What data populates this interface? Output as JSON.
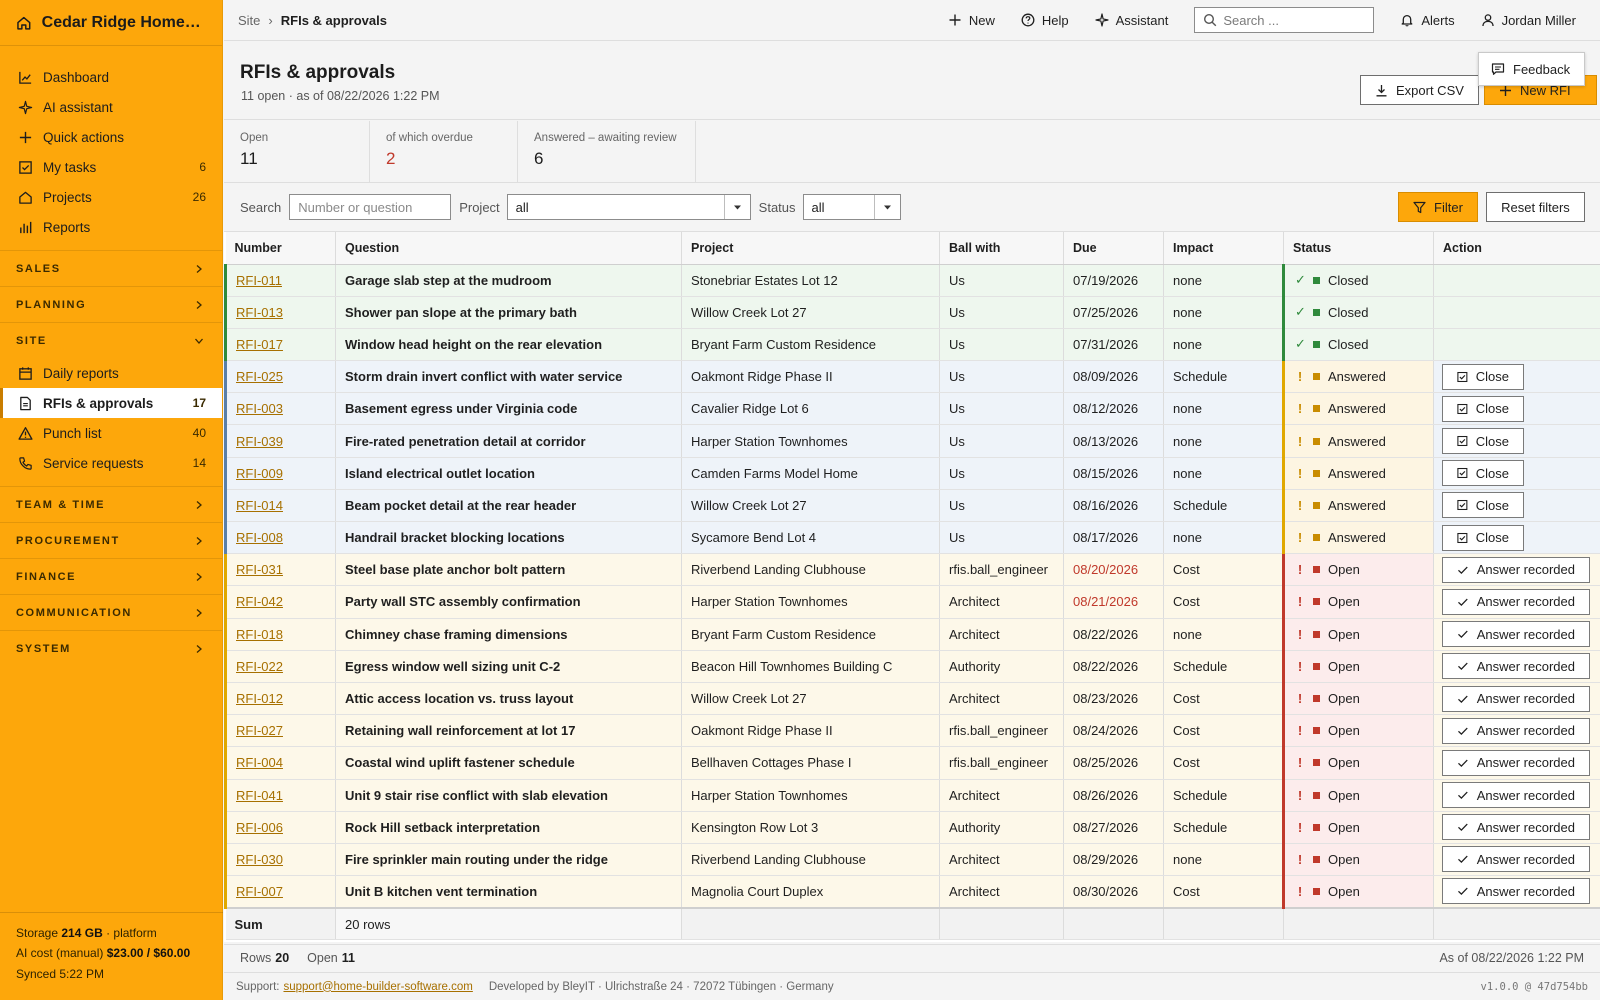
{
  "app": {
    "title": "Cedar Ridge Homes LLC"
  },
  "sidebar": {
    "items": [
      {
        "label": "Dashboard",
        "count": ""
      },
      {
        "label": "AI assistant",
        "count": ""
      },
      {
        "label": "Quick actions",
        "count": ""
      },
      {
        "label": "My tasks",
        "count": "6"
      },
      {
        "label": "Projects",
        "count": "26"
      },
      {
        "label": "Reports",
        "count": ""
      }
    ],
    "sections": {
      "sales": "SALES",
      "planning": "PLANNING",
      "site": "SITE",
      "team": "TEAM & TIME",
      "procurement": "PROCUREMENT",
      "finance": "FINANCE",
      "communication": "COMMUNICATION",
      "system": "SYSTEM"
    },
    "site_items": [
      {
        "label": "Daily reports",
        "count": ""
      },
      {
        "label": "RFIs & approvals",
        "count": "17"
      },
      {
        "label": "Punch list",
        "count": "40"
      },
      {
        "label": "Service requests",
        "count": "14"
      }
    ],
    "footer": {
      "storage_label": "Storage",
      "storage_value": "214 GB",
      "storage_suffix": "· platform",
      "ai_label": "AI cost (manual)",
      "ai_value": "$23.00 / $60.00",
      "synced": "Synced 5:22 PM"
    }
  },
  "topbar": {
    "crumb_root": "Site",
    "crumb_sep": "›",
    "crumb_current": "RFIs & approvals",
    "new_label": "New",
    "help_label": "Help",
    "assistant_label": "Assistant",
    "search_placeholder": "Search ...",
    "alerts_label": "Alerts",
    "user_name": "Jordan Miller"
  },
  "header": {
    "title": "RFIs & approvals",
    "subtitle": "11 open · as of 08/22/2026 1:22 PM",
    "export_label": "Export CSV",
    "new_rfi_label": "New RFI",
    "feedback_label": "Feedback"
  },
  "stats": [
    {
      "label": "Open",
      "value": "11"
    },
    {
      "label": "of which overdue",
      "value": "2"
    },
    {
      "label": "Answered – awaiting review",
      "value": "6"
    }
  ],
  "filters": {
    "search_label": "Search",
    "search_placeholder": "Number or question",
    "project_label": "Project",
    "project_value": "all",
    "status_label": "Status",
    "status_value": "all",
    "filter_label": "Filter",
    "reset_label": "Reset filters"
  },
  "table": {
    "columns": [
      "Number",
      "Question",
      "Project",
      "Ball with",
      "Due",
      "Impact",
      "Status",
      "Action"
    ],
    "rows": [
      {
        "number": "RFI-011",
        "question": "Garage slab step at the mudroom",
        "project": "Stonebriar Estates Lot 12",
        "ball": "Us",
        "due": "07/19/2026",
        "impact": "none",
        "status": "Closed",
        "action": ""
      },
      {
        "number": "RFI-013",
        "question": "Shower pan slope at the primary bath",
        "project": "Willow Creek Lot 27",
        "ball": "Us",
        "due": "07/25/2026",
        "impact": "none",
        "status": "Closed",
        "action": ""
      },
      {
        "number": "RFI-017",
        "question": "Window head height on the rear elevation",
        "project": "Bryant Farm Custom Residence",
        "ball": "Us",
        "due": "07/31/2026",
        "impact": "none",
        "status": "Closed",
        "action": ""
      },
      {
        "number": "RFI-025",
        "question": "Storm drain invert conflict with water service",
        "project": "Oakmont Ridge Phase II",
        "ball": "Us",
        "due": "08/09/2026",
        "impact": "Schedule",
        "status": "Answered",
        "action": "Close"
      },
      {
        "number": "RFI-003",
        "question": "Basement egress under Virginia code",
        "project": "Cavalier Ridge Lot 6",
        "ball": "Us",
        "due": "08/12/2026",
        "impact": "none",
        "status": "Answered",
        "action": "Close"
      },
      {
        "number": "RFI-039",
        "question": "Fire-rated penetration detail at corridor",
        "project": "Harper Station Townhomes",
        "ball": "Us",
        "due": "08/13/2026",
        "impact": "none",
        "status": "Answered",
        "action": "Close"
      },
      {
        "number": "RFI-009",
        "question": "Island electrical outlet location",
        "project": "Camden Farms Model Home",
        "ball": "Us",
        "due": "08/15/2026",
        "impact": "none",
        "status": "Answered",
        "action": "Close"
      },
      {
        "number": "RFI-014",
        "question": "Beam pocket detail at the rear header",
        "project": "Willow Creek Lot 27",
        "ball": "Us",
        "due": "08/16/2026",
        "impact": "Schedule",
        "status": "Answered",
        "action": "Close"
      },
      {
        "number": "RFI-008",
        "question": "Handrail bracket blocking locations",
        "project": "Sycamore Bend Lot 4",
        "ball": "Us",
        "due": "08/17/2026",
        "impact": "none",
        "status": "Answered",
        "action": "Close"
      },
      {
        "number": "RFI-031",
        "question": "Steel base plate anchor bolt pattern",
        "project": "Riverbend Landing Clubhouse",
        "ball": "rfis.ball_engineer",
        "due": "08/20/2026",
        "impact": "Cost",
        "status": "Open",
        "action": "Answer recorded",
        "overdue": true
      },
      {
        "number": "RFI-042",
        "question": "Party wall STC assembly confirmation",
        "project": "Harper Station Townhomes",
        "ball": "Architect",
        "due": "08/21/2026",
        "impact": "Cost",
        "status": "Open",
        "action": "Answer recorded",
        "overdue": true
      },
      {
        "number": "RFI-018",
        "question": "Chimney chase framing dimensions",
        "project": "Bryant Farm Custom Residence",
        "ball": "Architect",
        "due": "08/22/2026",
        "impact": "none",
        "status": "Open",
        "action": "Answer recorded"
      },
      {
        "number": "RFI-022",
        "question": "Egress window well sizing unit C-2",
        "project": "Beacon Hill Townhomes Building C",
        "ball": "Authority",
        "due": "08/22/2026",
        "impact": "Schedule",
        "status": "Open",
        "action": "Answer recorded"
      },
      {
        "number": "RFI-012",
        "question": "Attic access location vs. truss layout",
        "project": "Willow Creek Lot 27",
        "ball": "Architect",
        "due": "08/23/2026",
        "impact": "Cost",
        "status": "Open",
        "action": "Answer recorded"
      },
      {
        "number": "RFI-027",
        "question": "Retaining wall reinforcement at lot 17",
        "project": "Oakmont Ridge Phase II",
        "ball": "rfis.ball_engineer",
        "due": "08/24/2026",
        "impact": "Cost",
        "status": "Open",
        "action": "Answer recorded"
      },
      {
        "number": "RFI-004",
        "question": "Coastal wind uplift fastener schedule",
        "project": "Bellhaven Cottages Phase I",
        "ball": "rfis.ball_engineer",
        "due": "08/25/2026",
        "impact": "Cost",
        "status": "Open",
        "action": "Answer recorded"
      },
      {
        "number": "RFI-041",
        "question": "Unit 9 stair rise conflict with slab elevation",
        "project": "Harper Station Townhomes",
        "ball": "Architect",
        "due": "08/26/2026",
        "impact": "Schedule",
        "status": "Open",
        "action": "Answer recorded"
      },
      {
        "number": "RFI-006",
        "question": "Rock Hill setback interpretation",
        "project": "Kensington Row Lot 3",
        "ball": "Authority",
        "due": "08/27/2026",
        "impact": "Schedule",
        "status": "Open",
        "action": "Answer recorded"
      },
      {
        "number": "RFI-030",
        "question": "Fire sprinkler main routing under the ridge",
        "project": "Riverbend Landing Clubhouse",
        "ball": "Architect",
        "due": "08/29/2026",
        "impact": "none",
        "status": "Open",
        "action": "Answer recorded"
      },
      {
        "number": "RFI-007",
        "question": "Unit B kitchen vent termination",
        "project": "Magnolia Court Duplex",
        "ball": "Architect",
        "due": "08/30/2026",
        "impact": "Cost",
        "status": "Open",
        "action": "Answer recorded"
      }
    ],
    "sum_label": "Sum",
    "sum_value": "20 rows"
  },
  "statusbar": {
    "rows_label": "Rows",
    "rows_value": "20",
    "open_label": "Open",
    "open_value": "11",
    "as_of": "As of 08/22/2026 1:22 PM"
  },
  "footer": {
    "support_label": "Support:",
    "support_email": "support@home-builder-software.com",
    "developer": "Developed by BleyIT · Ulrichstraße 24 · 72072 Tübingen · Germany",
    "version": "v1.0.0 @ 47d754bb"
  },
  "colors": {
    "accent": "#fda70b",
    "closed": "#2f8a3c",
    "answered": "#c98c00",
    "open": "#c0392b"
  }
}
